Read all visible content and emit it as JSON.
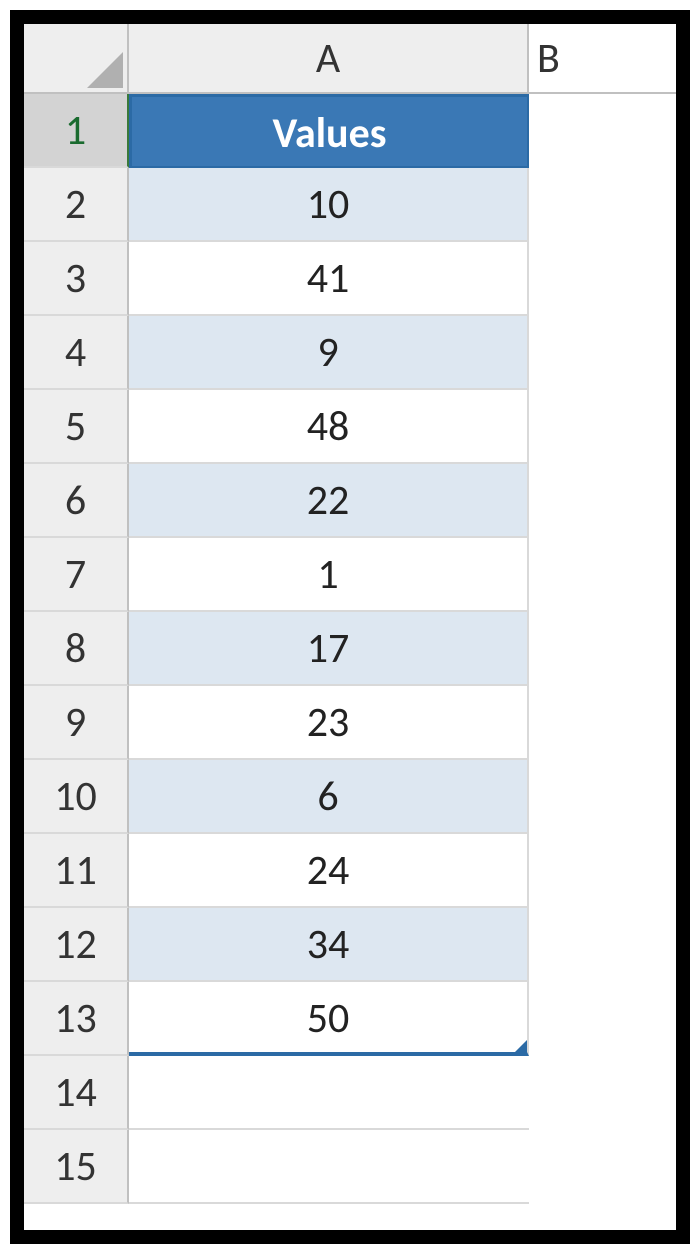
{
  "columns": [
    "A",
    "B"
  ],
  "header": "Values",
  "rows": [
    {
      "num": "1",
      "header": true,
      "value": "Values"
    },
    {
      "num": "2",
      "value": "10",
      "banded": true
    },
    {
      "num": "3",
      "value": "41"
    },
    {
      "num": "4",
      "value": "9",
      "banded": true
    },
    {
      "num": "5",
      "value": "48"
    },
    {
      "num": "6",
      "value": "22",
      "banded": true
    },
    {
      "num": "7",
      "value": "1"
    },
    {
      "num": "8",
      "value": "17",
      "banded": true
    },
    {
      "num": "9",
      "value": "23"
    },
    {
      "num": "10",
      "value": "6",
      "banded": true
    },
    {
      "num": "11",
      "value": "24"
    },
    {
      "num": "12",
      "value": "34",
      "banded": true
    },
    {
      "num": "13",
      "value": "50",
      "last": true
    }
  ],
  "empty_rows": [
    "14",
    "15"
  ],
  "chart_data": {
    "type": "table",
    "columns": [
      "Values"
    ],
    "data": [
      10,
      41,
      9,
      48,
      22,
      1,
      17,
      23,
      6,
      24,
      34,
      50
    ]
  }
}
